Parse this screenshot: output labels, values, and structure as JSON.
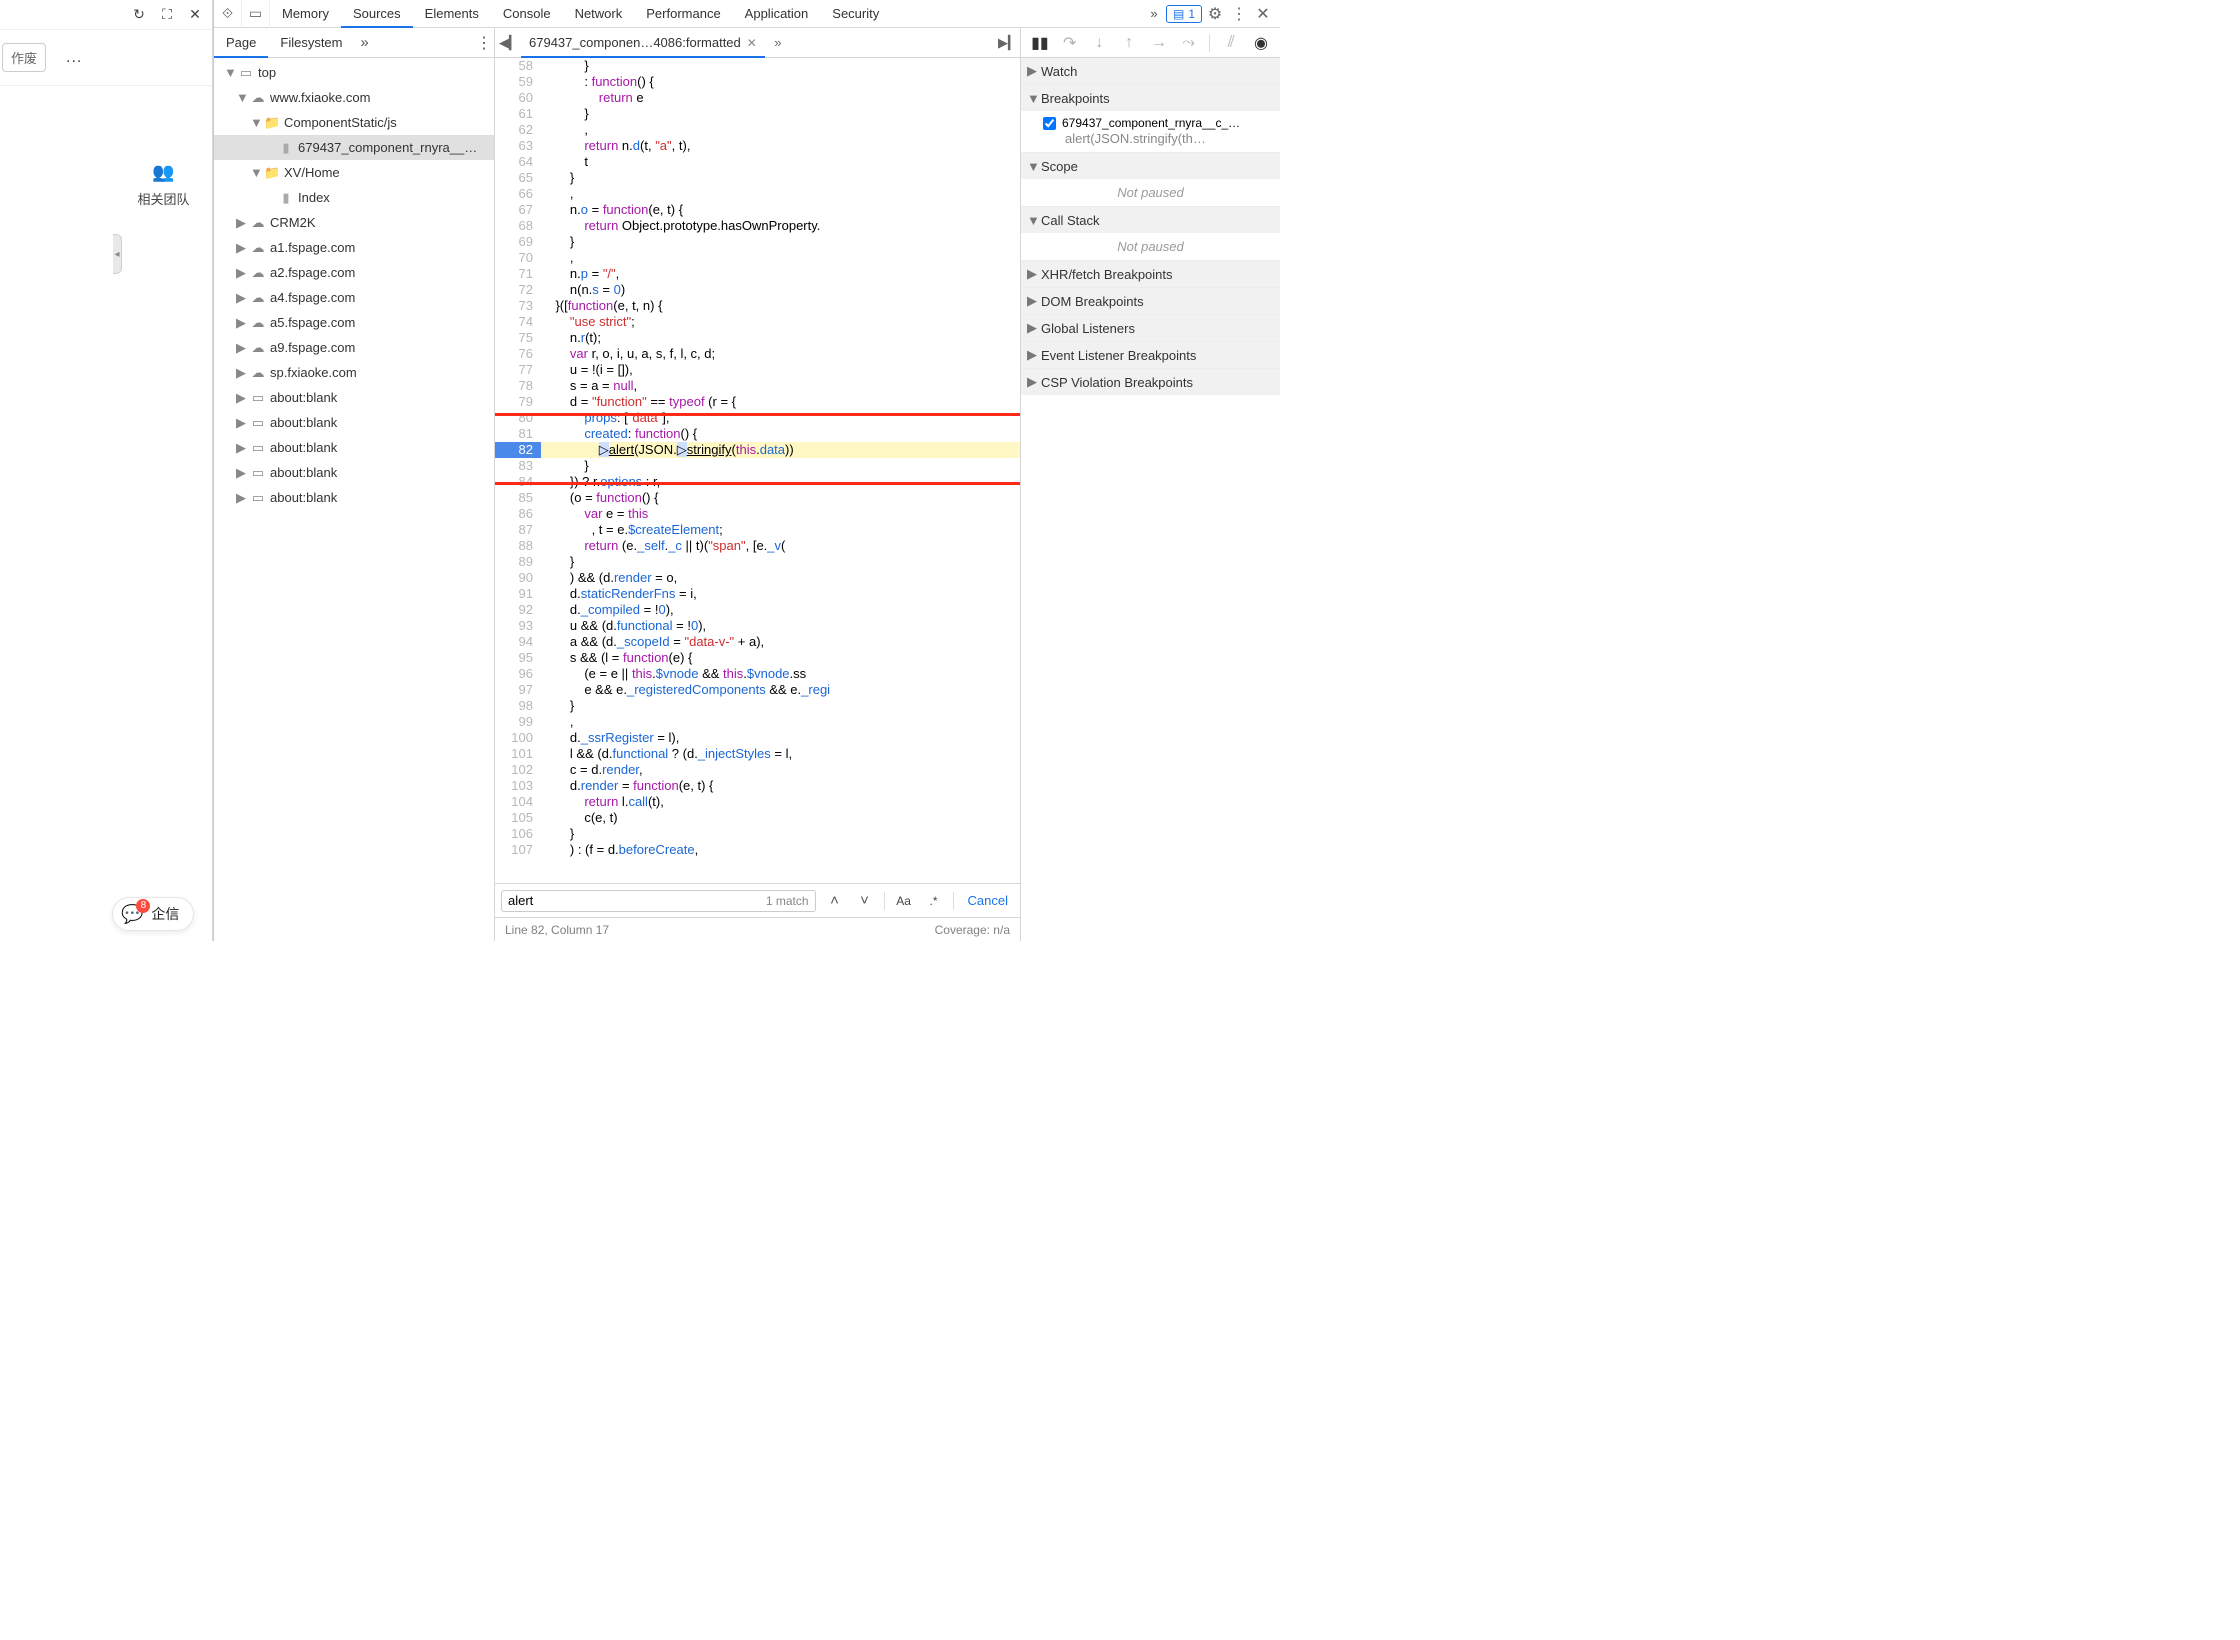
{
  "left": {
    "discard": "作废",
    "more": "...",
    "reload_icon": "↻",
    "expand_icon": "⛶",
    "close_icon": "✕",
    "team_label": "相关团队",
    "chat_label": "企信",
    "chat_badge": "8"
  },
  "toolbar": {
    "tabs": [
      "Memory",
      "Sources",
      "Elements",
      "Console",
      "Network",
      "Performance",
      "Application",
      "Security"
    ],
    "active": 1,
    "message_count": "1"
  },
  "nav": {
    "tabs": [
      "Page",
      "Filesystem"
    ],
    "active": 0,
    "tree": [
      {
        "d": 0,
        "tw": "▼",
        "ico": "win",
        "label": "top"
      },
      {
        "d": 1,
        "tw": "▼",
        "ico": "cloud",
        "label": "www.fxiaoke.com"
      },
      {
        "d": 2,
        "tw": "▼",
        "ico": "folder",
        "label": "ComponentStatic/js"
      },
      {
        "d": 3,
        "tw": "",
        "ico": "file",
        "label": "679437_component_rnyra__…",
        "sel": true
      },
      {
        "d": 2,
        "tw": "▼",
        "ico": "folder",
        "label": "XV/Home"
      },
      {
        "d": 3,
        "tw": "",
        "ico": "file",
        "label": "Index"
      },
      {
        "d": 1,
        "tw": "▶",
        "ico": "cloud",
        "label": "CRM2K"
      },
      {
        "d": 1,
        "tw": "▶",
        "ico": "cloud",
        "label": "a1.fspage.com"
      },
      {
        "d": 1,
        "tw": "▶",
        "ico": "cloud",
        "label": "a2.fspage.com"
      },
      {
        "d": 1,
        "tw": "▶",
        "ico": "cloud",
        "label": "a4.fspage.com"
      },
      {
        "d": 1,
        "tw": "▶",
        "ico": "cloud",
        "label": "a5.fspage.com"
      },
      {
        "d": 1,
        "tw": "▶",
        "ico": "cloud",
        "label": "a9.fspage.com"
      },
      {
        "d": 1,
        "tw": "▶",
        "ico": "cloud",
        "label": "sp.fxiaoke.com"
      },
      {
        "d": 1,
        "tw": "▶",
        "ico": "win",
        "label": "about:blank"
      },
      {
        "d": 1,
        "tw": "▶",
        "ico": "win",
        "label": "about:blank"
      },
      {
        "d": 1,
        "tw": "▶",
        "ico": "win",
        "label": "about:blank"
      },
      {
        "d": 1,
        "tw": "▶",
        "ico": "win",
        "label": "about:blank"
      },
      {
        "d": 1,
        "tw": "▶",
        "ico": "win",
        "label": "about:blank"
      }
    ]
  },
  "editor": {
    "tab_label": "679437_componen…4086:formatted",
    "overflow": "»",
    "exec_line": 82,
    "lines": [
      {
        "n": 58,
        "html": "            }"
      },
      {
        "n": 59,
        "html": "            : <span class='k-kw'>function</span>() {"
      },
      {
        "n": 60,
        "html": "                <span class='k-kw'>return</span> e"
      },
      {
        "n": 61,
        "html": "            }"
      },
      {
        "n": 62,
        "html": "            ,"
      },
      {
        "n": 63,
        "html": "            <span class='k-kw'>return</span> n.<span class='k-def'>d</span>(t, <span class='k-str'>\"a\"</span>, t),"
      },
      {
        "n": 64,
        "html": "            t"
      },
      {
        "n": 65,
        "html": "        }"
      },
      {
        "n": 66,
        "html": "        ,"
      },
      {
        "n": 67,
        "html": "        n.<span class='k-def'>o</span> = <span class='k-kw'>function</span>(e, t) {"
      },
      {
        "n": 68,
        "html": "            <span class='k-kw'>return</span> Object.prototype.hasOwnProperty."
      },
      {
        "n": 69,
        "html": "        }"
      },
      {
        "n": 70,
        "html": "        ,"
      },
      {
        "n": 71,
        "html": "        n.<span class='k-def'>p</span> = <span class='k-str'>\"/\"</span>,"
      },
      {
        "n": 72,
        "html": "        n(n.<span class='k-def'>s</span> = <span class='k-num'>0</span>)"
      },
      {
        "n": 73,
        "html": "    }([<span class='k-kw'>function</span>(e, t, n) {"
      },
      {
        "n": 74,
        "html": "        <span class='k-str'>\"use strict\"</span>;"
      },
      {
        "n": 75,
        "html": "        n.<span class='k-def'>r</span>(t);"
      },
      {
        "n": 76,
        "html": "        <span class='k-kw'>var</span> r, o, i, u, a, s, f, l, c, d;"
      },
      {
        "n": 77,
        "html": "        u = !(i = []),"
      },
      {
        "n": 78,
        "html": "        s = a = <span class='k-kw'>null</span>,"
      },
      {
        "n": 79,
        "html": "        d = <span class='k-str'>\"function\"</span> == <span class='k-kw'>typeof</span> (r = {"
      },
      {
        "n": 80,
        "html": "            <span class='k-def'>props</span>: [<span class='k-str'>\"data\"</span>],"
      },
      {
        "n": 81,
        "html": "            <span class='k-def'>created</span>: <span class='k-kw'>function</span>() {"
      },
      {
        "n": 82,
        "html": "                <span style='background:#cfe0ff'>▷</span><span style='text-decoration:underline'>alert</span>(JSON.<span style='background:#cfe0ff'>▷</span><span style='text-decoration:underline'>stringify</span>(<span class='k-kw'>this</span>.<span class='k-def'>data</span>))"
      },
      {
        "n": 83,
        "html": "            }"
      },
      {
        "n": 84,
        "html": "        }) ? r.<span class='k-def'>options</span> : r,"
      },
      {
        "n": 85,
        "html": "        (o = <span class='k-kw'>function</span>() {"
      },
      {
        "n": 86,
        "html": "            <span class='k-kw'>var</span> e = <span class='k-kw'>this</span>"
      },
      {
        "n": 87,
        "html": "              , t = e.<span class='k-def'>$createElement</span>;"
      },
      {
        "n": 88,
        "html": "            <span class='k-kw'>return</span> (e.<span class='k-def'>_self</span>.<span class='k-def'>_c</span> || t)(<span class='k-str'>\"span\"</span>, [e.<span class='k-def'>_v</span>("
      },
      {
        "n": 89,
        "html": "        }"
      },
      {
        "n": 90,
        "html": "        ) && (d.<span class='k-def'>render</span> = o,"
      },
      {
        "n": 91,
        "html": "        d.<span class='k-def'>staticRenderFns</span> = i,"
      },
      {
        "n": 92,
        "html": "        d.<span class='k-def'>_compiled</span> = !<span class='k-num'>0</span>),"
      },
      {
        "n": 93,
        "html": "        u && (d.<span class='k-def'>functional</span> = !<span class='k-num'>0</span>),"
      },
      {
        "n": 94,
        "html": "        a && (d.<span class='k-def'>_scopeId</span> = <span class='k-str'>\"data-v-\"</span> + a),"
      },
      {
        "n": 95,
        "html": "        s && (l = <span class='k-kw'>function</span>(e) {"
      },
      {
        "n": 96,
        "html": "            (e = e || <span class='k-kw'>this</span>.<span class='k-def'>$vnode</span> && <span class='k-kw'>this</span>.<span class='k-def'>$vnode</span>.ss"
      },
      {
        "n": 97,
        "html": "            e && e.<span class='k-def'>_registeredComponents</span> && e.<span class='k-def'>_regi</span>"
      },
      {
        "n": 98,
        "html": "        }"
      },
      {
        "n": 99,
        "html": "        ,"
      },
      {
        "n": 100,
        "html": "        d.<span class='k-def'>_ssrRegister</span> = l),"
      },
      {
        "n": 101,
        "html": "        l && (d.<span class='k-def'>functional</span> ? (d.<span class='k-def'>_injectStyles</span> = l,"
      },
      {
        "n": 102,
        "html": "        c = d.<span class='k-def'>render</span>,"
      },
      {
        "n": 103,
        "html": "        d.<span class='k-def'>render</span> = <span class='k-kw'>function</span>(e, t) {"
      },
      {
        "n": 104,
        "html": "            <span class='k-kw'>return</span> l.<span class='k-def'>call</span>(t),"
      },
      {
        "n": 105,
        "html": "            c(e, t)"
      },
      {
        "n": 106,
        "html": "        }"
      },
      {
        "n": 107,
        "html": "        ) : (f = d.<span class='k-def'>beforeCreate</span>,"
      }
    ]
  },
  "search": {
    "query": "alert",
    "result": "1 match",
    "case": "Aa",
    "regex": ".*",
    "cancel": "Cancel"
  },
  "status": {
    "pos": "Line 82, Column 17",
    "coverage": "Coverage: n/a"
  },
  "debug": {
    "watch": "Watch",
    "breakpoints": "Breakpoints",
    "bp_file": "679437_component_rnyra__c_…",
    "bp_code": "alert(JSON.stringify(th…",
    "scope": "Scope",
    "notpaused": "Not paused",
    "callstack": "Call Stack",
    "xhr": "XHR/fetch Breakpoints",
    "dom": "DOM Breakpoints",
    "global": "Global Listeners",
    "event": "Event Listener Breakpoints",
    "csp": "CSP Violation Breakpoints"
  }
}
